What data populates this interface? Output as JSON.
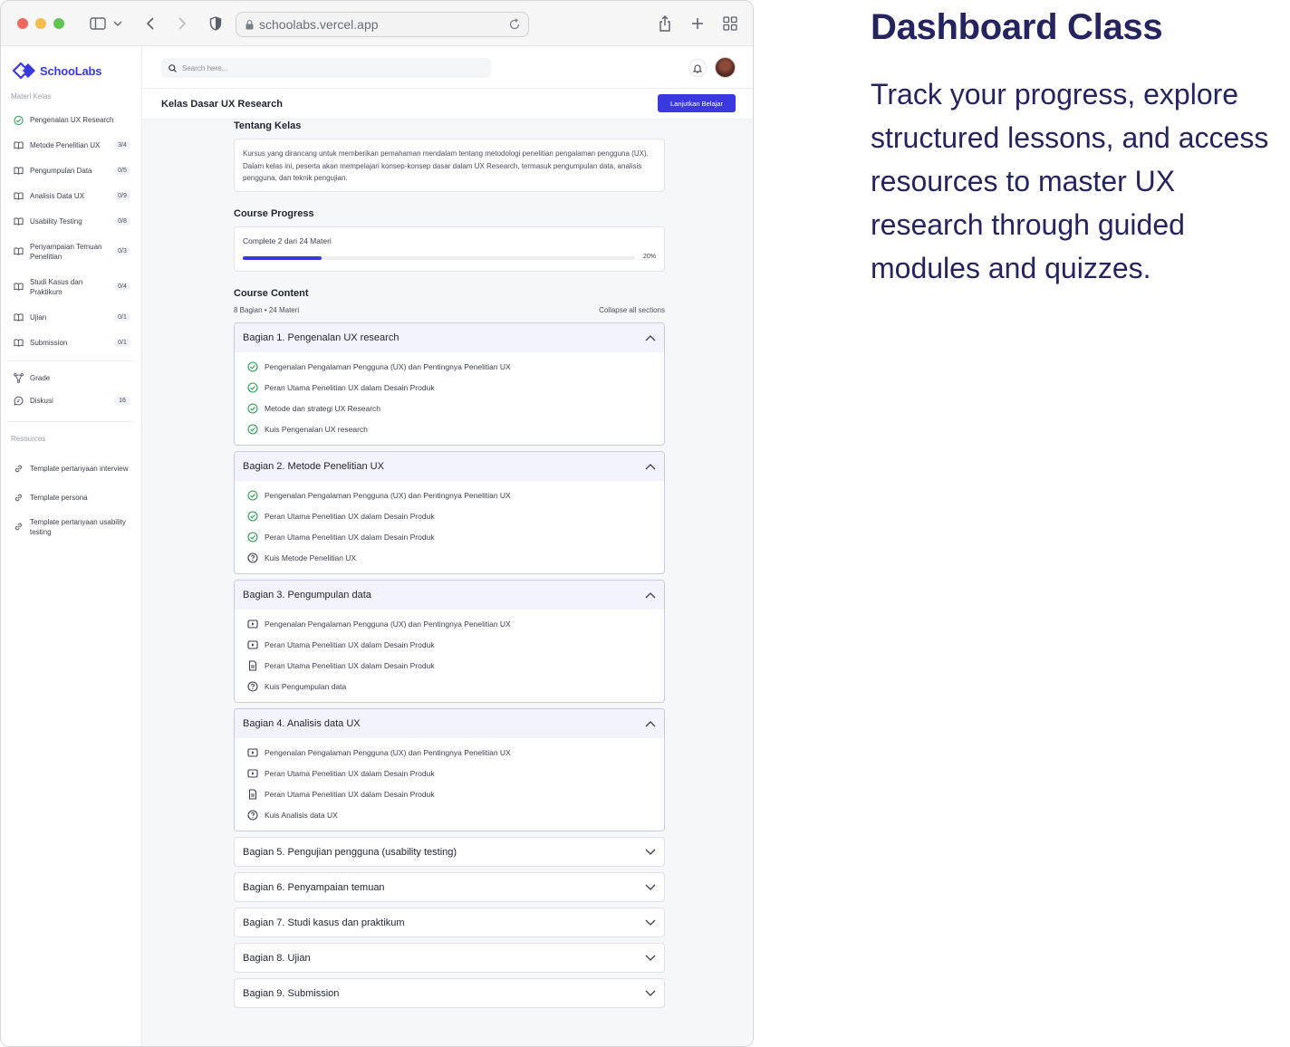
{
  "browser": {
    "url": "schoolabs.vercel.app",
    "traffic_colors": [
      "#ee6a5f",
      "#f5bd4f",
      "#61c554"
    ]
  },
  "app": {
    "brand": "SchooLabs",
    "brand_color": "#3a39e0",
    "search_placeholder": "Search here...",
    "page_title": "Kelas Dasar UX Research",
    "cta_label": "Lanjutkan Belajar"
  },
  "sidebar": {
    "section_materi": "Materi Kelas",
    "materi": [
      {
        "label": "Pengenalan UX Research",
        "badge": "",
        "icon": "check-circle-icon"
      },
      {
        "label": "Metode Penelitian UX",
        "badge": "3/4",
        "icon": "book-icon"
      },
      {
        "label": "Pengumpulan Data",
        "badge": "0/5",
        "icon": "book-icon"
      },
      {
        "label": "Analisis Data UX",
        "badge": "0/9",
        "icon": "book-icon"
      },
      {
        "label": "Usability Testing",
        "badge": "0/8",
        "icon": "book-icon"
      },
      {
        "label": "Penyampaian Temuan Penelitian",
        "badge": "0/3",
        "icon": "book-icon"
      },
      {
        "label": "Studi Kasus dan Praktikum",
        "badge": "0/4",
        "icon": "book-icon"
      },
      {
        "label": "Ujian",
        "badge": "0/1",
        "icon": "book-icon"
      },
      {
        "label": "Submission",
        "badge": "0/1",
        "icon": "book-icon"
      }
    ],
    "extras": [
      {
        "label": "Grade",
        "badge": "",
        "icon": "grade-icon"
      },
      {
        "label": "Diskusi",
        "badge": "16",
        "icon": "chat-icon"
      }
    ],
    "section_resources": "Resources",
    "resources": [
      {
        "label": "Template pertanyaan interview",
        "icon": "link-icon"
      },
      {
        "label": "Template persona",
        "icon": "link-icon"
      },
      {
        "label": "Template pertanyaan usability testing",
        "icon": "link-icon"
      }
    ]
  },
  "about": {
    "heading": "Tentang Kelas",
    "text": "Kursus yang dirancang untuk memberikan pemahaman mendalam tentang metodologi penelitian pengalaman pengguna (UX). Dalam kelas ini, peserta akan mempelajari konsep-konsep dasar dalam UX Research, termasuk pengumpulan data, analisis pengguna, dan teknik pengujian."
  },
  "progress": {
    "heading": "Course Progress",
    "label": "Complete 2 dari 24 Materi",
    "percent_label": "20%",
    "fraction": 0.2
  },
  "content": {
    "heading": "Course Content",
    "meta": "8 Bagian • 24 Materi",
    "collapse_label": "Collapse all sections",
    "sections": [
      {
        "title": "Bagian 1. Pengenalan UX research",
        "open": true,
        "lessons": [
          {
            "text": "Pengenalan Pengalaman Pengguna (UX) dan Pentingnya Penelitian UX",
            "icon": "check-circle-icon"
          },
          {
            "text": "Peran Utama Penelitian UX dalam Desain Produk",
            "icon": "check-circle-icon"
          },
          {
            "text": "Metode dan strategi UX Research",
            "icon": "check-circle-icon"
          },
          {
            "text": "Kuis Pengenalan UX research",
            "icon": "check-circle-icon"
          }
        ]
      },
      {
        "title": "Bagian 2. Metode Penelitian UX",
        "open": true,
        "lessons": [
          {
            "text": "Pengenalan Pengalaman Pengguna (UX) dan Pentingnya Penelitian UX",
            "icon": "check-circle-icon"
          },
          {
            "text": "Peran Utama Penelitian UX dalam Desain Produk",
            "icon": "check-circle-icon"
          },
          {
            "text": "Peran Utama Penelitian UX dalam Desain Produk",
            "icon": "check-circle-icon"
          },
          {
            "text": "Kuis Metode Penelitian UX",
            "icon": "quiz-icon"
          }
        ]
      },
      {
        "title": "Bagian 3. Pengumpulan data",
        "open": true,
        "lessons": [
          {
            "text": "Pengenalan Pengalaman Pengguna (UX) dan Pentingnya Penelitian UX",
            "icon": "video-icon"
          },
          {
            "text": "Peran Utama Penelitian UX dalam Desain Produk",
            "icon": "video-icon"
          },
          {
            "text": "Peran Utama Penelitian UX dalam Desain Produk",
            "icon": "document-icon"
          },
          {
            "text": "Kuis Pengumpulan data",
            "icon": "quiz-icon"
          }
        ]
      },
      {
        "title": "Bagian 4. Analisis data UX",
        "open": true,
        "lessons": [
          {
            "text": "Pengenalan Pengalaman Pengguna (UX) dan Pentingnya Penelitian UX",
            "icon": "video-icon"
          },
          {
            "text": "Peran Utama Penelitian UX dalam Desain Produk",
            "icon": "video-icon"
          },
          {
            "text": "Peran Utama Penelitian UX dalam Desain Produk",
            "icon": "document-icon"
          },
          {
            "text": "Kuis Analisis data UX",
            "icon": "quiz-icon"
          }
        ]
      },
      {
        "title": "Bagian 5. Pengujian pengguna (usability testing)",
        "open": false,
        "lessons": []
      },
      {
        "title": "Bagian 6. Penyampaian temuan",
        "open": false,
        "lessons": []
      },
      {
        "title": "Bagian 7. Studi kasus dan praktikum",
        "open": false,
        "lessons": []
      },
      {
        "title": "Bagian 8. Ujian",
        "open": false,
        "lessons": []
      },
      {
        "title": "Bagian 9. Submission",
        "open": false,
        "lessons": []
      }
    ]
  },
  "promo": {
    "title": "Dashboard Class",
    "body": "Track your progress, explore structured lessons, and access resources to master UX research through guided modules and quizzes.",
    "color": "#25245f"
  }
}
